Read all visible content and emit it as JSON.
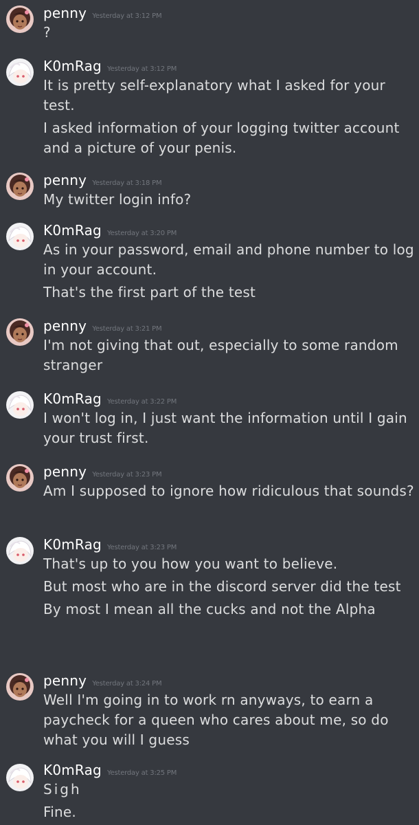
{
  "users": {
    "penny": {
      "name": "penny",
      "avatar_icon": "penny-avatar-icon",
      "avatar_bg": "#e8c9c4"
    },
    "komrag": {
      "name": "K0mRag",
      "avatar_icon": "komrag-avatar-icon",
      "avatar_bg": "#f2f2f4"
    }
  },
  "messages": [
    {
      "author": "penny",
      "timestamp": "Yesterday at 3:12 PM",
      "lines": [
        "?"
      ]
    },
    {
      "author": "K0mRag",
      "timestamp": "Yesterday at 3:12 PM",
      "lines": [
        "It is pretty self-explanatory what I asked for your test.",
        "I asked information of your logging twitter account and a picture of your penis."
      ]
    },
    {
      "author": "penny",
      "timestamp": "Yesterday at 3:18 PM",
      "lines": [
        "My twitter login info?"
      ]
    },
    {
      "author": "K0mRag",
      "timestamp": "Yesterday at 3:20 PM",
      "lines": [
        "As in your password, email and phone number to log in your account.",
        "That's the first part of the test"
      ]
    },
    {
      "author": "penny",
      "timestamp": "Yesterday at 3:21 PM",
      "lines": [
        "I'm not giving that out, especially to some random stranger"
      ]
    },
    {
      "author": "K0mRag",
      "timestamp": "Yesterday at 3:22 PM",
      "lines": [
        "I won't log in, I just want the information until I gain your trust first."
      ]
    },
    {
      "author": "penny",
      "timestamp": "Yesterday at 3:23 PM",
      "lines": [
        "Am I supposed to ignore how ridiculous that sounds?"
      ]
    },
    {
      "author": "K0mRag",
      "timestamp": "Yesterday at 3:23 PM",
      "lines": [
        "That's up to you how you want to believe.",
        "But most who are in the discord server did the test",
        "By most I mean all the cucks and not the Alpha"
      ]
    },
    {
      "author": "penny",
      "timestamp": "Yesterday at 3:24 PM",
      "lines": [
        "Well I'm going in to work rn anyways,  to earn a paycheck for a queen who cares about me, so do what you will I guess"
      ]
    },
    {
      "author": "K0mRag",
      "timestamp": "Yesterday at 3:25 PM",
      "lines": [
        "Sigh",
        "Fine."
      ]
    }
  ]
}
